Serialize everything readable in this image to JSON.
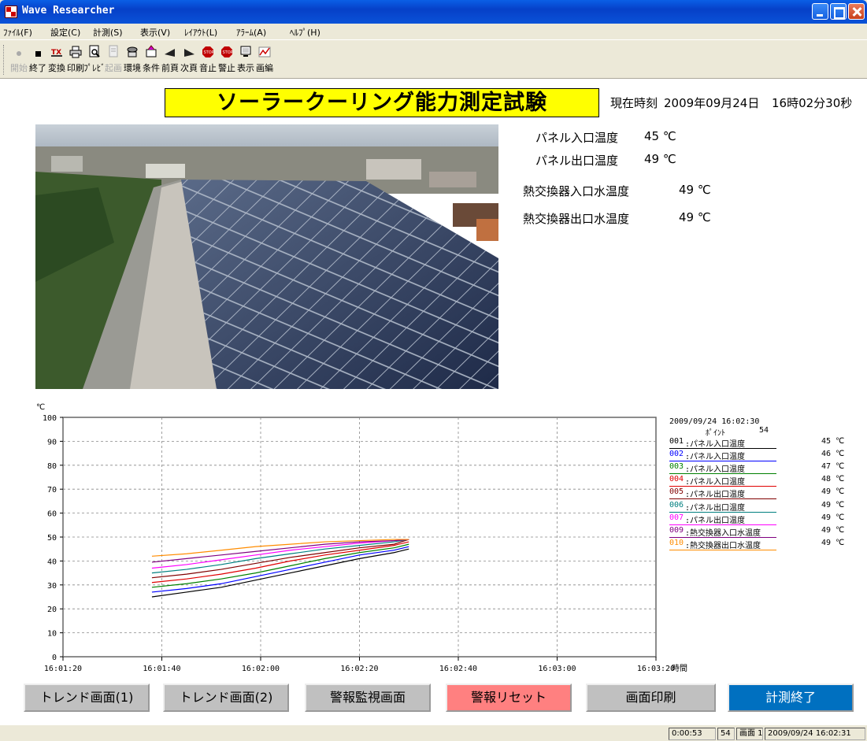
{
  "window": {
    "title": "Wave Researcher"
  },
  "menu": [
    "ﾌｧｲﾙ(F)",
    "設定(C)",
    "計測(S)",
    "表示(V)",
    "ﾚｲｱｳﾄ(L)",
    "ｱﾗｰﾑ(A)",
    "ﾍﾙﾌﾟ(H)"
  ],
  "toolbar": [
    {
      "label": "開始",
      "icon": "record-dot-icon",
      "enabled": false
    },
    {
      "label": "終了",
      "icon": "stop-square-icon",
      "enabled": true
    },
    {
      "label": "変換",
      "icon": "tx-convert-icon",
      "enabled": true
    },
    {
      "label": "印刷",
      "icon": "printer-icon",
      "enabled": true
    },
    {
      "label": "ﾌﾟﾚﾋﾞ",
      "icon": "print-preview-icon",
      "enabled": true
    },
    {
      "label": "起画",
      "icon": "document-icon",
      "enabled": false
    },
    {
      "label": "環境",
      "icon": "environment-icon",
      "enabled": true
    },
    {
      "label": "条件",
      "icon": "condition-icon",
      "enabled": true
    },
    {
      "label": "前頁",
      "icon": "prev-page-icon",
      "enabled": true
    },
    {
      "label": "次頁",
      "icon": "next-page-icon",
      "enabled": true
    },
    {
      "label": "音止",
      "icon": "stop-sign-icon",
      "enabled": true
    },
    {
      "label": "警止",
      "icon": "stop-sign-icon",
      "enabled": true
    },
    {
      "label": "表示",
      "icon": "monitor-icon",
      "enabled": true
    },
    {
      "label": "画編",
      "icon": "graph-edit-icon",
      "enabled": true
    }
  ],
  "header": {
    "title": "ソーラークーリング能力測定試験",
    "time_label": "現在時刻",
    "date": "2009年09月24日",
    "time": "16時02分30秒"
  },
  "readings": [
    {
      "label": "パネル入口温度",
      "value": "45 ℃"
    },
    {
      "label": "パネル出口温度",
      "value": "49 ℃"
    },
    {
      "label": "熱交換器入口水温度",
      "value": "49 ℃"
    },
    {
      "label": "熱交換器出口水温度",
      "value": "49 ℃"
    }
  ],
  "chart_data": {
    "type": "line",
    "yunit": "℃",
    "xunit": "時間",
    "ylim": [
      0,
      100
    ],
    "yticks": [
      0,
      10,
      20,
      30,
      40,
      50,
      60,
      70,
      80,
      90,
      100
    ],
    "xticks": [
      "16:01:20",
      "16:01:40",
      "16:02:00",
      "16:02:20",
      "16:02:40",
      "16:03:00",
      "16:03:20"
    ],
    "grid": true,
    "x": [
      "16:01:38",
      "16:01:45",
      "16:01:52",
      "16:01:59",
      "16:02:06",
      "16:02:13",
      "16:02:20",
      "16:02:27",
      "16:02:30"
    ],
    "series": [
      {
        "name": "001:パネル入口温度",
        "color": "#000000",
        "values": [
          25,
          27,
          29,
          32,
          35,
          38,
          41,
          43.5,
          45
        ]
      },
      {
        "name": "002:パネル入口温度",
        "color": "#0000ff",
        "values": [
          27,
          28.5,
          30.5,
          33.5,
          36.5,
          39.5,
          42.5,
          44.5,
          46
        ]
      },
      {
        "name": "003:パネル入口温度",
        "color": "#008000",
        "values": [
          29,
          30.5,
          32.5,
          35,
          38,
          41,
          43.5,
          45.5,
          47
        ]
      },
      {
        "name": "004:パネル入口温度",
        "color": "#e00000",
        "values": [
          31,
          32.5,
          34.5,
          37,
          40,
          42.5,
          44.5,
          46.5,
          48
        ]
      },
      {
        "name": "005:パネル出口温度",
        "color": "#800000",
        "values": [
          33,
          34.5,
          36.5,
          39,
          41.5,
          43.5,
          45.5,
          47,
          49
        ]
      },
      {
        "name": "006:パネル出口温度",
        "color": "#008080",
        "values": [
          35,
          36.5,
          38.5,
          41,
          43,
          45,
          46.5,
          48,
          49
        ]
      },
      {
        "name": "007:パネル出口温度",
        "color": "#ff00ff",
        "values": [
          37,
          38.5,
          40.5,
          42.5,
          44.5,
          46,
          47.5,
          48.5,
          49
        ]
      },
      {
        "name": "009:熱交換器入口水温度",
        "color": "#800080",
        "values": [
          39.5,
          41,
          42.5,
          44,
          45.5,
          47,
          48,
          48.5,
          49
        ]
      },
      {
        "name": "010:熱交換器出口水温度",
        "color": "#ff8c00",
        "values": [
          42,
          43,
          44.5,
          46,
          47,
          48,
          48.5,
          49,
          49
        ]
      }
    ]
  },
  "legend": {
    "datetime": "2009/09/24 16:02:30",
    "point_label": "ﾎﾟｲﾝﾄ",
    "point_count": "54",
    "values": [
      "45 ℃",
      "46 ℃",
      "47 ℃",
      "48 ℃",
      "49 ℃",
      "49 ℃",
      "49 ℃",
      "49 ℃",
      "49 ℃"
    ]
  },
  "buttons": [
    {
      "label": "トレンド画面(1)",
      "bg": "#c0c0c0",
      "fg": "#000000"
    },
    {
      "label": "トレンド画面(2)",
      "bg": "#c0c0c0",
      "fg": "#000000"
    },
    {
      "label": "警報監視画面",
      "bg": "#c0c0c0",
      "fg": "#000000"
    },
    {
      "label": "警報リセット",
      "bg": "#ff8080",
      "fg": "#000000"
    },
    {
      "label": "画面印刷",
      "bg": "#c0c0c0",
      "fg": "#000000"
    },
    {
      "label": "計測終了",
      "bg": "#0070c0",
      "fg": "#ffffff"
    }
  ],
  "status": {
    "elapsed": "0:00:53",
    "count": "54",
    "screen": "画面 1",
    "datetime": "2009/09/24  16:02:31"
  }
}
